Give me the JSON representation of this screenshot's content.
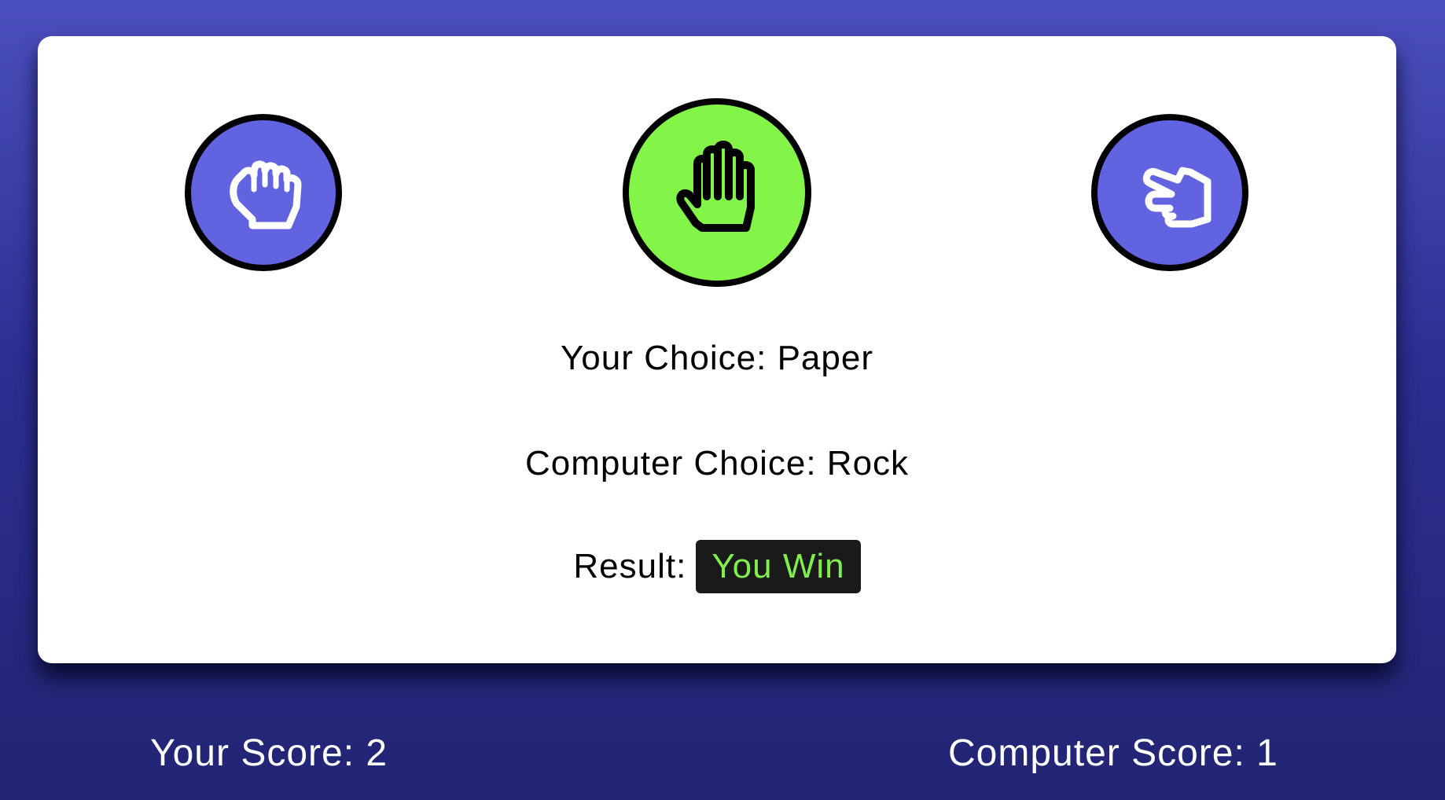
{
  "game": {
    "choices": [
      {
        "name": "Rock",
        "icon": "fist-icon",
        "selected": false
      },
      {
        "name": "Paper",
        "icon": "open-hand-icon",
        "selected": true
      },
      {
        "name": "Scissors",
        "icon": "hand-scissors-icon",
        "selected": false
      }
    ],
    "your_choice_label": "Your Choice:",
    "your_choice_value": "Paper",
    "computer_choice_label": "Computer Choice:",
    "computer_choice_value": "Rock",
    "result_label": "Result:",
    "result_value": "You Win"
  },
  "scores": {
    "player_label": "Your Score:",
    "player_value": "2",
    "computer_label": "Computer Score:",
    "computer_value": "1"
  },
  "colors": {
    "choice_bg": "#6163e0",
    "selected_bg": "#83f548",
    "icon_default": "#ffffff",
    "icon_selected": "#000000",
    "result_badge_bg": "#1a1a1a",
    "result_text": "#80ef4b"
  }
}
